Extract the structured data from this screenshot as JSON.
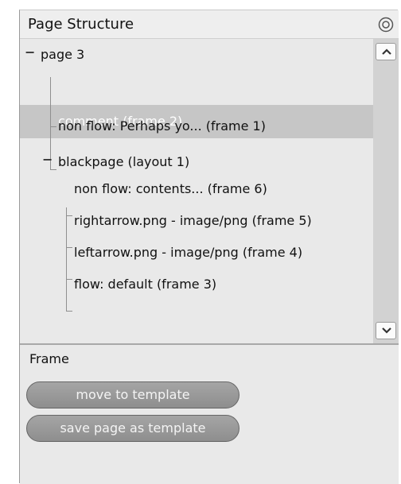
{
  "header": {
    "title": "Page Structure",
    "close_icon": "circle-close-icon"
  },
  "tree": {
    "root": {
      "toggle": "−",
      "label": "page 3"
    },
    "items": [
      {
        "label": "comment (frame 2)",
        "selected": true
      },
      {
        "label": "non flow: Perhaps yo... (frame 1)"
      }
    ],
    "group": {
      "toggle": "−",
      "label": "blackpage (layout 1)",
      "children": [
        {
          "label": "non flow: contents... (frame 6)"
        },
        {
          "label": "rightarrow.png - image/png (frame 5)"
        },
        {
          "label": "leftarrow.png - image/png (frame 4)"
        },
        {
          "label": "flow: default (frame 3)"
        }
      ]
    }
  },
  "bottom": {
    "label": "Frame",
    "move_button": "move to template",
    "save_button": "save page as template"
  }
}
